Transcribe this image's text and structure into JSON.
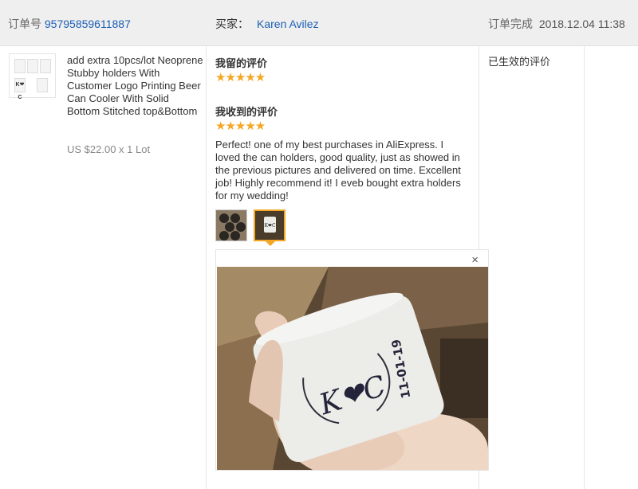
{
  "header": {
    "order_label": "订单号",
    "order_number": "95795859611887",
    "buyer_label": "买家：",
    "buyer_name": "Karen Avilez",
    "status_label": "订单完成",
    "status_time": "2018.12.04 11:38"
  },
  "product": {
    "title": "add extra 10pcs/lot Neoprene Stubby holders With Customer Logo Printing Beer Can Cooler With Solid Bottom Stitched top&Bottom",
    "price": "US $22.00 x 1 Lot",
    "thumbnail_monogram": "K❤C"
  },
  "feedback": {
    "given_title": "我留的评价",
    "given_rating": 5,
    "given_stars": "★★★★★",
    "received_title": "我收到的评价",
    "received_rating": 5,
    "received_stars": "★★★★★",
    "review_text": "Perfect! one of my best purchases in AliExpress. I loved the can holders, good quality, just as showed in the previous pictures and delivered on time. Excellent job! Highly recommend it! I eveb bought extra holders for my wedding!",
    "close_icon": "×",
    "photo_monogram": "K❤C",
    "photo_date": "11-01-19"
  },
  "status": {
    "text": "已生效的评价"
  },
  "colors": {
    "link": "#1b5fb4",
    "star": "#f5a623",
    "header_bg": "#efefef"
  }
}
